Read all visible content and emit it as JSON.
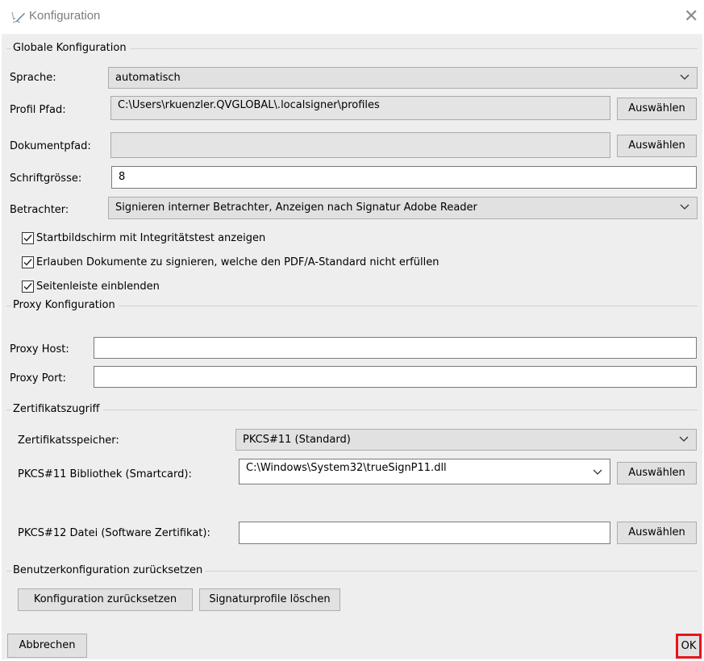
{
  "window": {
    "title": "Konfiguration",
    "close_icon": "close-icon",
    "app_icon": "signature-pen-icon"
  },
  "global": {
    "legend": "Globale Konfiguration",
    "language_label": "Sprache:",
    "language_value": "automatisch",
    "profile_path_label": "Profil Pfad:",
    "profile_path_value": "C:\\Users\\rkuenzler.QVGLOBAL\\.localsigner\\profiles",
    "profile_path_button": "Auswählen",
    "document_path_label": "Dokumentpfad:",
    "document_path_value": "",
    "document_path_button": "Auswählen",
    "font_size_label": "Schriftgrösse:",
    "font_size_value": "8",
    "viewer_label": "Betrachter:",
    "viewer_value": "Signieren interner Betrachter, Anzeigen nach Signatur Adobe Reader",
    "checkboxes": [
      {
        "label": "Startbildschirm mit Integritätstest anzeigen",
        "checked": true
      },
      {
        "label": "Erlauben Dokumente zu signieren, welche den PDF/A-Standard nicht erfüllen",
        "checked": true
      },
      {
        "label": "Seitenleiste einblenden",
        "checked": true
      }
    ]
  },
  "proxy": {
    "legend": "Proxy Konfiguration",
    "host_label": "Proxy Host:",
    "host_value": "",
    "port_label": "Proxy Port:",
    "port_value": ""
  },
  "certificate": {
    "legend": "Zertifikatszugriff",
    "store_label": "Zertifikatsspeicher:",
    "store_value": "PKCS#11 (Standard)",
    "pkcs11_label": "PKCS#11 Bibliothek (Smartcard):",
    "pkcs11_value": "C:\\Windows\\System32\\trueSignP11.dll",
    "pkcs11_button": "Auswählen",
    "pkcs12_label": "PKCS#12 Datei (Software Zertifikat):",
    "pkcs12_value": "",
    "pkcs12_button": "Auswählen"
  },
  "reset": {
    "legend": "Benutzerkonfiguration zurücksetzen",
    "reset_config_button": "Konfiguration zurücksetzen",
    "delete_profiles_button": "Signaturprofile löschen"
  },
  "footer": {
    "cancel_button": "Abbrechen",
    "ok_button": "OK",
    "ok_highlight_color": "#e8141b"
  }
}
